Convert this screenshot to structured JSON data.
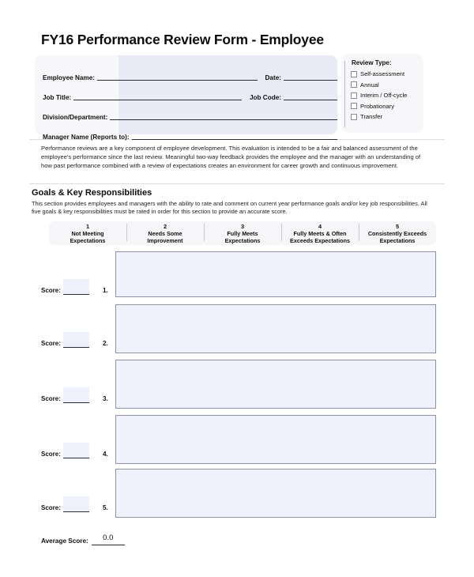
{
  "document": {
    "title": "FY16 Performance Review Form - Employee"
  },
  "employee_info": {
    "fields": [
      {
        "label": "Employee Name:",
        "value": ""
      },
      {
        "label": "Job Title:",
        "value": ""
      },
      {
        "label": "Division/Department:",
        "value": ""
      },
      {
        "label": "Manager Name (Reports to):",
        "value": ""
      }
    ],
    "date_label": "Date:",
    "date_value": "",
    "job_code_label": "Job Code:",
    "job_code_value": ""
  },
  "review_type": {
    "title": "Review Type:",
    "options": [
      {
        "label": "Self-assessment",
        "checked": false
      },
      {
        "label": "Annual",
        "checked": false
      },
      {
        "label": "Interim / Off-cycle",
        "checked": false
      },
      {
        "label": "Probationary",
        "checked": false
      },
      {
        "label": "Transfer",
        "checked": false
      }
    ]
  },
  "intro": {
    "paragraph": "Performance reviews are a key component of employee development.  This evaluation is intended to be a fair and balanced assessment of the employee's performance since the last review.  Meaningful two-way feedback provides the employee  and the manager with an understanding of how past performance combined with a review of expectations creates an environment for career growth and continuous improvement."
  },
  "goals_section": {
    "title": "Goals & Key Responsibilities",
    "description": "This section provides employees and managers with the ability to rate and comment on current year performance goals and/or key job responsibilities.  All five goals & key responsibilities must be rated in order for this section to provide an accurate  score.",
    "rating_scale": [
      {
        "number": "1",
        "line1": "Not Meeting",
        "line2": "Expectations"
      },
      {
        "number": "2",
        "line1": "Needs Some",
        "line2": "Improvement"
      },
      {
        "number": "3",
        "line1": "Fully Meets",
        "line2": "Expectations"
      },
      {
        "number": "4",
        "line1": "Fully Meets & Often",
        "line2": "Exceeds Expectations"
      },
      {
        "number": "5",
        "line1": "Consistently Exceeds",
        "line2": "Expectations"
      }
    ],
    "score_label": "Score:",
    "rows": [
      {
        "number": "1.",
        "score": "",
        "text": ""
      },
      {
        "number": "2.",
        "score": "",
        "text": ""
      },
      {
        "number": "3.",
        "score": "",
        "text": ""
      },
      {
        "number": "4.",
        "score": "",
        "text": ""
      },
      {
        "number": "5.",
        "score": "",
        "text": ""
      }
    ],
    "average_label": "Average Score:",
    "average_value": "0.0"
  },
  "colors": {
    "field_fill": "#e9ebf7",
    "panel_fill": "#f7f7f9",
    "textarea_fill": "#eff1fd",
    "textarea_border": "#8e91a8",
    "rule": "#dddde2"
  }
}
